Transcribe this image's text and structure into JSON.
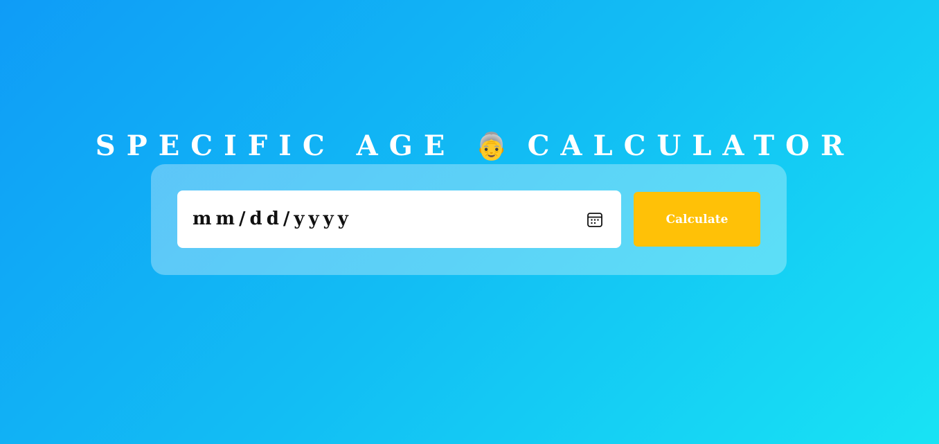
{
  "header": {
    "title_left": "SPECIFIC AGE",
    "title_emoji": "👵",
    "title_right": "CALCULATOR"
  },
  "form": {
    "date_placeholder": "mm/dd/yyyy",
    "calendar_icon": "calendar-icon",
    "calculate_label": "Calculate"
  },
  "colors": {
    "background_start": "#0f9cf7",
    "background_end": "#18e3f4",
    "button": "#ffc107",
    "field": "#ffffff"
  }
}
